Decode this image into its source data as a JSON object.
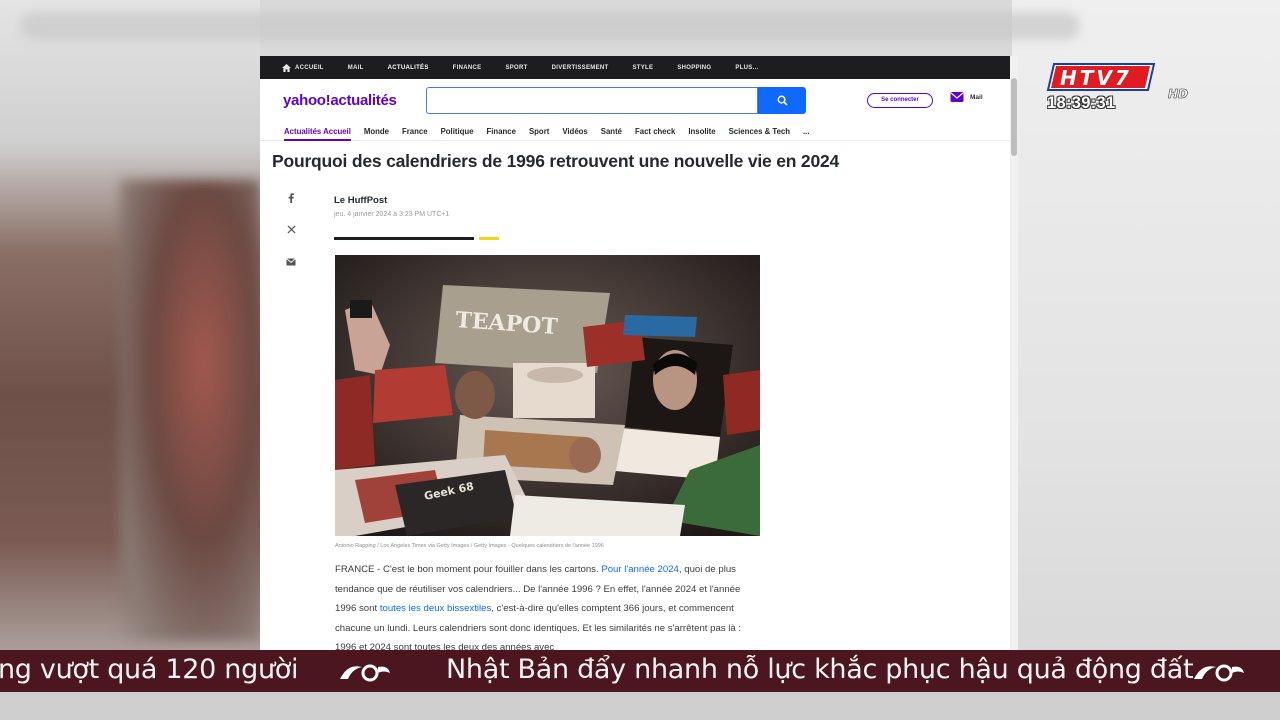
{
  "broadcast": {
    "channel_logo_text": "HTV7",
    "channel_logo_suffix": "HD",
    "clock": "18:39:31",
    "ticker_left": "ng vượt quá 120 người",
    "ticker_main": "Nhật Bản đẩy nhanh nỗ lực khắc phục hậu quả động đất",
    "ticker_brand_icon": "htv-swirl-logo",
    "ticker_bg_color": "#4c1620"
  },
  "topnav": {
    "items": [
      "ACCUEIL",
      "MAIL",
      "ACTUALITÉS",
      "FINANCE",
      "SPORT",
      "DIVERTISSEMENT",
      "STYLE",
      "SHOPPING",
      "PLUS..."
    ],
    "active_index": 2
  },
  "header": {
    "logo": "yahoo!actualités",
    "search_placeholder": "",
    "signin_label": "Se connecter",
    "mail_label": "Mail",
    "brand_color": "#5f01d1",
    "search_color": "#0f69ff"
  },
  "subnav": {
    "items": [
      "Actualités Accueil",
      "Monde",
      "France",
      "Politique",
      "Finance",
      "Sport",
      "Vidéos",
      "Santé",
      "Fact check",
      "Insolite",
      "Sciences & Tech",
      "..."
    ],
    "active_index": 0
  },
  "article": {
    "headline": "Pourquoi des calendriers de 1996 retrouvent une nouvelle vie en 2024",
    "source": "Le HuffPost",
    "date": "jeu. 4 janvier 2024 à 3:23 PM UTC+1",
    "share_icons": [
      "facebook-icon",
      "x-icon",
      "email-icon"
    ],
    "photo_labels": {
      "teapot": "TEAPOT",
      "booklet": "Geek 68"
    },
    "caption": "Antonio Rapping / Los Angeles Times via Getty Images / Getty Images - Quelques calendriers de l'année 1996",
    "p1_a": "FRANCE - C'est le bon moment pour fouiller dans les cartons. ",
    "p1_link": "Pour l'année 2024",
    "p1_b": ", quoi de plus tendance que de réutiliser vos calendriers... De l'année 1996 ? En effet, l'année 2024 et l'année 1996 sont ",
    "p1_link2": "toutes les deux bissextiles",
    "p1_c": ", c'est-à-dire qu'elles comptent 366 jours, et commencent chacune un lundi. Leurs calendriers sont donc identiques. Et les similarités ne s'arrêtent pas là : 1996 et 2024 sont toutes les deux des années avec"
  }
}
